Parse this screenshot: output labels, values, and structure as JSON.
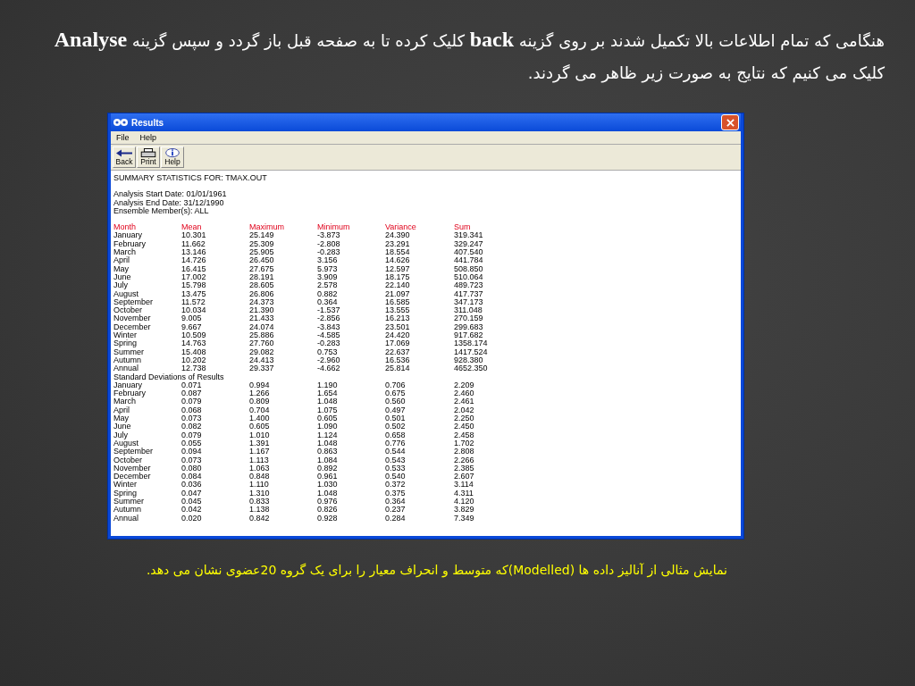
{
  "intro": "هنگامی که تمام اطلاعات بالا تکمیل شدند بر روی گزینه **back** کلیک کرده تا به صفحه قبل باز گردد و سپس گزینه **Analyse** کلیک می کنیم که نتایج به صورت زیر ظاهر می گردند.",
  "window": {
    "title": "Results",
    "menu": [
      "File",
      "Help"
    ],
    "toolbar": [
      {
        "kind": "back",
        "label": "Back"
      },
      {
        "kind": "print",
        "label": "Print"
      },
      {
        "kind": "help",
        "label": "Help"
      }
    ],
    "summary": "SUMMARY STATISTICS FOR: TMAX.OUT",
    "info": [
      "Analysis Start Date: 01/01/1961",
      "Analysis End Date: 31/12/1990",
      "Ensemble Member(s): ALL"
    ],
    "columns": [
      "Month",
      "Mean",
      "Maximum",
      "Minimum",
      "Variance",
      "Sum"
    ],
    "rows": [
      [
        "January",
        "10.301",
        "25.149",
        "-3.873",
        "24.390",
        "319.341"
      ],
      [
        "February",
        "11.662",
        "25.309",
        "-2.808",
        "23.291",
        "329.247"
      ],
      [
        "March",
        "13.146",
        "25.905",
        "-0.283",
        "18.554",
        "407.540"
      ],
      [
        "April",
        "14.726",
        "26.450",
        "3.156",
        "14.626",
        "441.784"
      ],
      [
        "May",
        "16.415",
        "27.675",
        "5.973",
        "12.597",
        "508.850"
      ],
      [
        "June",
        "17.002",
        "28.191",
        "3.909",
        "18.175",
        "510.064"
      ],
      [
        "July",
        "15.798",
        "28.605",
        "2.578",
        "22.140",
        "489.723"
      ],
      [
        "August",
        "13.475",
        "26.806",
        "0.882",
        "21.097",
        "417.737"
      ],
      [
        "September",
        "11.572",
        "24.373",
        "0.364",
        "16.585",
        "347.173"
      ],
      [
        "October",
        "10.034",
        "21.390",
        "-1.537",
        "13.555",
        "311.048"
      ],
      [
        "November",
        "9.005",
        "21.433",
        "-2.856",
        "16.213",
        "270.159"
      ],
      [
        "December",
        "9.667",
        "24.074",
        "-3.843",
        "23.501",
        "299.683"
      ],
      [
        "Winter",
        "10.509",
        "25.886",
        "-4.585",
        "24.420",
        "917.682"
      ],
      [
        "Spring",
        "14.763",
        "27.760",
        "-0.283",
        "17.069",
        "1358.174"
      ],
      [
        "Summer",
        "15.408",
        "29.082",
        "0.753",
        "22.637",
        "1417.524"
      ],
      [
        "Autumn",
        "10.202",
        "24.413",
        "-2.960",
        "16.536",
        "928.380"
      ],
      [
        "Annual",
        "12.738",
        "29.337",
        "-4.662",
        "25.814",
        "4652.350"
      ]
    ],
    "sd_heading": "Standard Deviations of Results",
    "sd_rows": [
      [
        "January",
        "0.071",
        "0.994",
        "1.190",
        "0.706",
        "2.209"
      ],
      [
        "February",
        "0.087",
        "1.266",
        "1.654",
        "0.675",
        "2.460"
      ],
      [
        "March",
        "0.079",
        "0.809",
        "1.048",
        "0.560",
        "2.461"
      ],
      [
        "April",
        "0.068",
        "0.704",
        "1.075",
        "0.497",
        "2.042"
      ],
      [
        "May",
        "0.073",
        "1.400",
        "0.605",
        "0.501",
        "2.250"
      ],
      [
        "June",
        "0.082",
        "0.605",
        "1.090",
        "0.502",
        "2.450"
      ],
      [
        "July",
        "0.079",
        "1.010",
        "1.124",
        "0.658",
        "2.458"
      ],
      [
        "August",
        "0.055",
        "1.391",
        "1.048",
        "0.776",
        "1.702"
      ],
      [
        "September",
        "0.094",
        "1.167",
        "0.863",
        "0.544",
        "2.808"
      ],
      [
        "October",
        "0.073",
        "1.113",
        "1.084",
        "0.543",
        "2.266"
      ],
      [
        "November",
        "0.080",
        "1.063",
        "0.892",
        "0.533",
        "2.385"
      ],
      [
        "December",
        "0.084",
        "0.848",
        "0.961",
        "0.540",
        "2.607"
      ],
      [
        "Winter",
        "0.036",
        "1.110",
        "1.030",
        "0.372",
        "3.114"
      ],
      [
        "Spring",
        "0.047",
        "1.310",
        "1.048",
        "0.375",
        "4.311"
      ],
      [
        "Summer",
        "0.045",
        "0.833",
        "0.976",
        "0.364",
        "4.120"
      ],
      [
        "Autumn",
        "0.042",
        "1.138",
        "0.826",
        "0.237",
        "3.829"
      ],
      [
        "Annual",
        "0.020",
        "0.842",
        "0.928",
        "0.284",
        "7.349"
      ]
    ]
  },
  "caption": "نمایش مثالی از آنالیز داده ها   (Modelled)که متوسط و انحراف معیار را برای یک گروه   20عضوی نشان می دهد."
}
